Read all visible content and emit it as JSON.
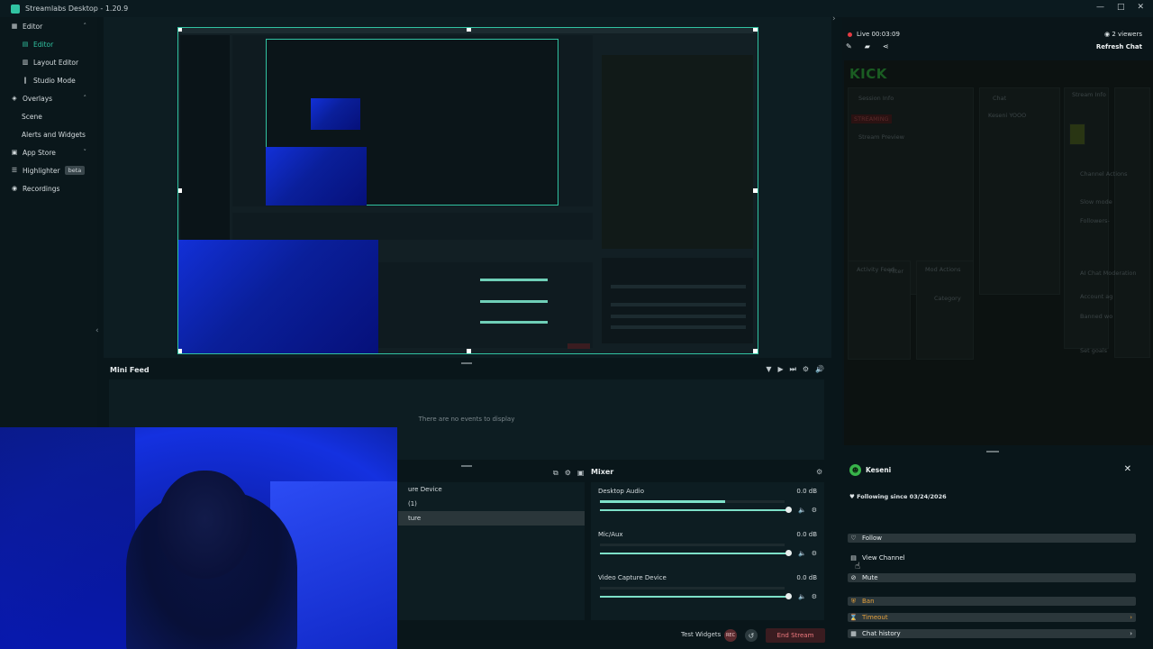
{
  "app": {
    "title": "Streamlabs Desktop - 1.20.9",
    "window_controls": [
      "—",
      "□",
      "✕"
    ]
  },
  "sidebar": {
    "items": [
      {
        "label": "Editor",
        "icon": "grid-icon",
        "glyph": "▦",
        "level": 0,
        "chevron": "˄"
      },
      {
        "label": "Editor",
        "icon": "editor-icon",
        "glyph": "▤",
        "level": 1,
        "active": true
      },
      {
        "label": "Layout Editor",
        "icon": "layout-icon",
        "glyph": "▥",
        "level": 1
      },
      {
        "label": "Studio Mode",
        "icon": "studio-icon",
        "glyph": "‖",
        "level": 1
      },
      {
        "label": "Overlays",
        "icon": "overlays-icon",
        "glyph": "◈",
        "level": 0,
        "chevron": "˄"
      },
      {
        "label": "Scene",
        "level": 1
      },
      {
        "label": "Alerts and Widgets",
        "level": 1
      },
      {
        "label": "App Store",
        "icon": "store-icon",
        "glyph": "▣",
        "level": 0,
        "chevron": "˅"
      },
      {
        "label": "Highlighter",
        "icon": "highlighter-icon",
        "glyph": "☰",
        "level": 0,
        "badge": "beta"
      },
      {
        "label": "Recordings",
        "icon": "record-icon",
        "glyph": "◉",
        "level": 0
      }
    ]
  },
  "mini_feed": {
    "title": "Mini Feed",
    "empty_text": "There are no events to display",
    "icons": [
      "▼",
      "▶",
      "⏭",
      "⚙",
      "🔊"
    ]
  },
  "sources": {
    "rows": [
      {
        "label": "ure Device",
        "selected": false
      },
      {
        "label": "(1)",
        "selected": false
      },
      {
        "label": "ture",
        "selected": true
      }
    ]
  },
  "mixer": {
    "title": "Mixer",
    "items": [
      {
        "name": "Desktop Audio",
        "db": "0.0 dB",
        "level": 0.68
      },
      {
        "name": "Mic/Aux",
        "db": "0.0 dB",
        "level": 0.0
      },
      {
        "name": "Video Capture Device",
        "db": "0.0 dB",
        "level": 0.0
      }
    ]
  },
  "footer": {
    "test_widgets": "Test Widgets",
    "rec": "REC",
    "end_stream": "End Stream"
  },
  "chat": {
    "live_time": "Live 00:03:09",
    "viewers": "2 viewers",
    "refresh": "Refresh Chat",
    "kick": {
      "logo": "KICK",
      "session_info": "Session Info",
      "chat": "Chat",
      "stream_info": "Stream Info",
      "streaming": "STREAMING",
      "stream_preview": "Stream Preview",
      "chat_message": "Keseni YOOO",
      "channel_actions": "Channel Actions",
      "slow_mode": "Slow mode",
      "followers": "Followers-",
      "activity_feed": "Activity Feed",
      "mod_actions": "Mod Actions",
      "filter": "Filter",
      "ai_chat_moderation": "AI Chat Moderation",
      "account_age": "Account ag",
      "banned_words": "Banned wo",
      "set_goals": "Set goals",
      "category": "Category"
    }
  },
  "user_card": {
    "name": "Keseni",
    "following_since": "Following since 03/24/2026",
    "actions": [
      {
        "label": "Follow",
        "icon": "heart-icon",
        "glyph": "♡",
        "bar": true,
        "warn": false,
        "arrow": false
      },
      {
        "label": "View Channel",
        "icon": "channel-icon",
        "glyph": "▤",
        "bar": false,
        "warn": false,
        "arrow": false
      },
      {
        "label": "Mute",
        "icon": "mute-icon",
        "glyph": "⊘",
        "bar": true,
        "warn": false,
        "arrow": false
      },
      {
        "label": "Ban",
        "icon": "ban-icon",
        "glyph": "⛨",
        "bar": true,
        "warn": true,
        "arrow": false
      },
      {
        "label": "Timeout",
        "icon": "hourglass-icon",
        "glyph": "⌛",
        "bar": true,
        "warn": true,
        "arrow": true
      },
      {
        "label": "Chat history",
        "icon": "history-icon",
        "glyph": "▦",
        "bar": true,
        "warn": false,
        "arrow": true
      }
    ]
  },
  "colors": {
    "accent": "#31c3a2",
    "live": "#e53b43",
    "warn": "#e5a13c",
    "end_stream": "#ef7a7f"
  }
}
